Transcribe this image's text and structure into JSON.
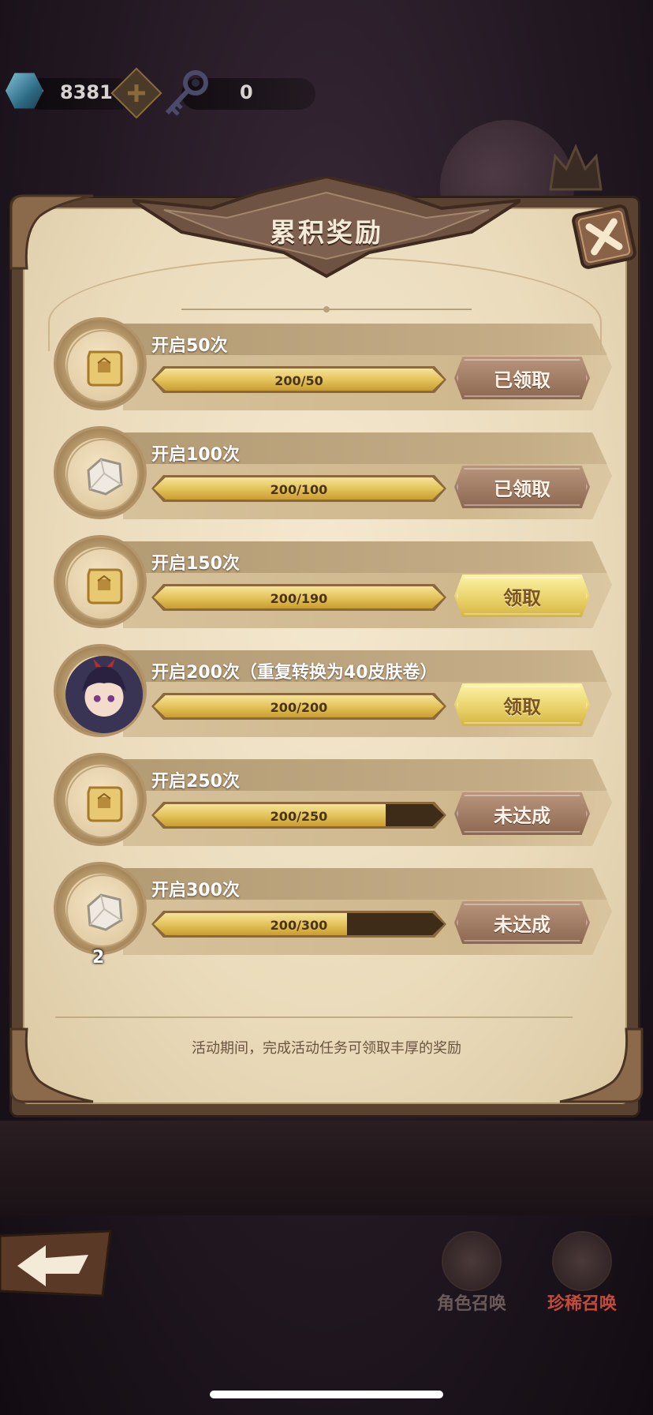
{
  "currency": {
    "gems": "8381",
    "keys": "0"
  },
  "panel": {
    "title": "累积奖励",
    "footer_note": "活动期间，完成活动任务可领取丰厚的奖励"
  },
  "rewards": [
    {
      "label": "开启50次",
      "progress_text": "200/50",
      "progress": 1.0,
      "status": "已领取",
      "state": "claimed",
      "item": "scroll-icon",
      "count": ""
    },
    {
      "label": "开启100次",
      "progress_text": "200/100",
      "progress": 1.0,
      "status": "已领取",
      "state": "claimed",
      "item": "stone-icon",
      "count": ""
    },
    {
      "label": "开启150次",
      "progress_text": "200/190",
      "progress": 1.0,
      "status": "领取",
      "state": "claim",
      "item": "scroll-icon",
      "count": ""
    },
    {
      "label": "开启200次（重复转换为40皮肤卷）",
      "progress_text": "200/200",
      "progress": 1.0,
      "status": "领取",
      "state": "claim",
      "item": "character-portrait-icon",
      "count": ""
    },
    {
      "label": "开启250次",
      "progress_text": "200/250",
      "progress": 0.8,
      "status": "未达成",
      "state": "unmet",
      "item": "scroll-icon",
      "count": ""
    },
    {
      "label": "开启300次",
      "progress_text": "200/300",
      "progress": 0.667,
      "status": "未达成",
      "state": "unmet",
      "item": "stone-icon",
      "count": "2"
    }
  ],
  "bottom_nav": {
    "summon_character": "角色召唤",
    "summon_rare": "珍稀召唤"
  },
  "colors": {
    "claim_button": "#e8d066",
    "claimed_button": "#a07c66",
    "progress_fill": "#e4c45c",
    "rare_summon_label": "#c44a3a",
    "character_summon_label": "#6a5a58"
  }
}
